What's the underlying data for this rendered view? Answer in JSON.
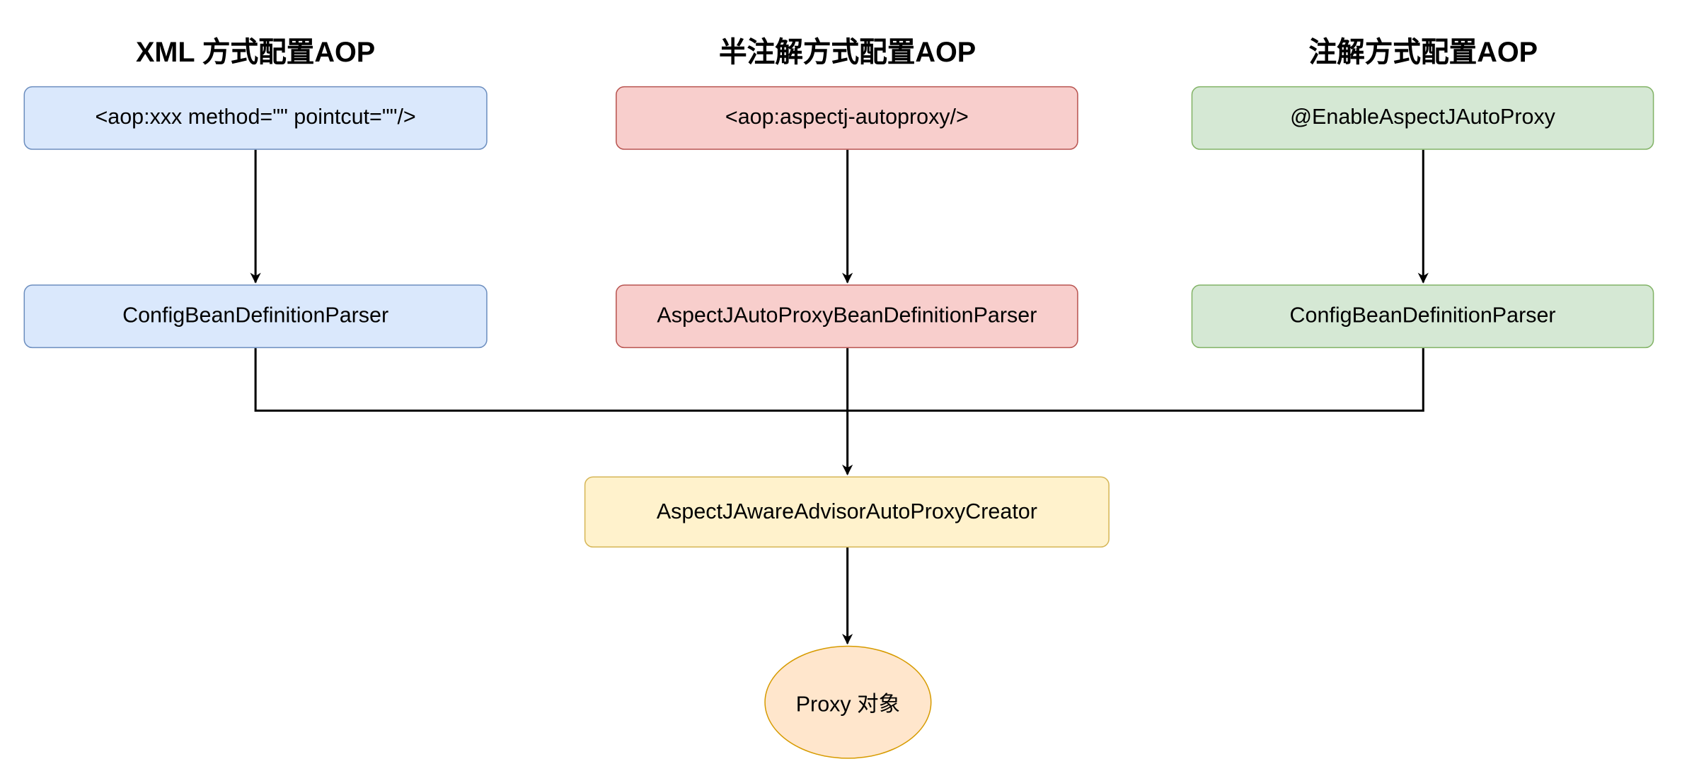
{
  "columns": [
    {
      "title": "XML 方式配置AOP",
      "config": "<aop:xxx method=\"\" pointcut=\"\"/>",
      "parser": "ConfigBeanDefinitionParser"
    },
    {
      "title": "半注解方式配置AOP",
      "config": "<aop:aspectj-autoproxy/>",
      "parser": "AspectJAutoProxyBeanDefinitionParser"
    },
    {
      "title": "注解方式配置AOP",
      "config": "@EnableAspectJAutoProxy",
      "parser": "ConfigBeanDefinitionParser"
    }
  ],
  "creator": "AspectJAwareAdvisorAutoProxyCreator",
  "result": "Proxy 对象",
  "colors": {
    "blue_fill": "#dae8fc",
    "red_fill": "#f8cecc",
    "green_fill": "#d5e8d4",
    "yellow_fill": "#fff2cc",
    "orange_fill": "#ffe6cc"
  }
}
